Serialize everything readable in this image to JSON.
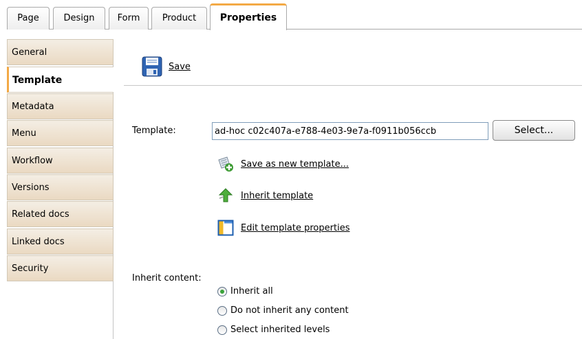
{
  "top_tabs": [
    "Page",
    "Design",
    "Form",
    "Product",
    "Properties"
  ],
  "active_tab": "Properties",
  "menu": {
    "items": [
      "General",
      "Template",
      "Metadata",
      "Menu",
      "Workflow",
      "Versions",
      "Related docs",
      "Linked docs",
      "Security"
    ],
    "active": "Template"
  },
  "toolbar": {
    "save_label": "Save"
  },
  "template": {
    "label": "Template:",
    "value": "ad-hoc c02c407a-e788-4e03-9e7a-f0911b056ccb",
    "select_label": "Select..."
  },
  "actions": {
    "save_as_new": "Save as new template...",
    "inherit": "Inherit template",
    "edit_properties": "Edit template properties"
  },
  "inherit_content": {
    "label": "Inherit content:",
    "options": [
      "Inherit all",
      "Do not inherit any content",
      "Select inherited levels"
    ],
    "selected": "Inherit all"
  },
  "colors": {
    "accent": "#f3a945",
    "menu_bg": "#ead9c2",
    "radio_dot": "#3aa33a"
  }
}
